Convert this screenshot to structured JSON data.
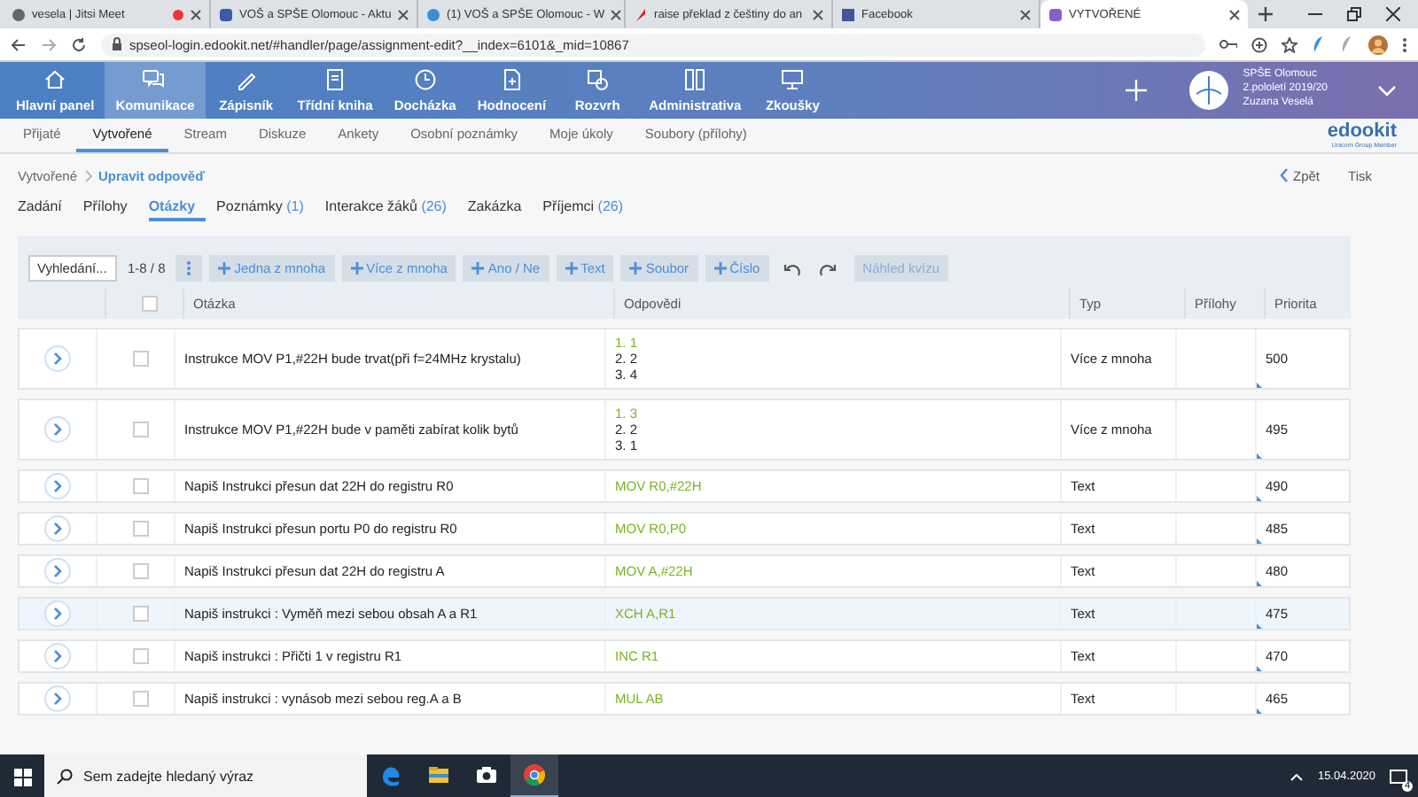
{
  "browser": {
    "tabs": [
      {
        "title": "vesela | Jitsi Meet",
        "selected": false,
        "recording": true
      },
      {
        "title": "VOŠ a SPŠE Olomouc - Aktu",
        "selected": false,
        "recording": false
      },
      {
        "title": "(1) VOŠ a SPŠE Olomouc - W",
        "selected": false,
        "recording": false
      },
      {
        "title": "raise překlad z češtiny do an",
        "selected": false,
        "recording": false
      },
      {
        "title": "Facebook",
        "selected": false,
        "recording": false
      },
      {
        "title": "VYTVOŘENÉ",
        "selected": true,
        "recording": false
      }
    ],
    "address": "spseol-login.edookit.net/#handler/page/assignment-edit?__index=6101&_mid=10867"
  },
  "app_nav": {
    "items": [
      {
        "label": "Hlavní panel",
        "selected": false
      },
      {
        "label": "Komunikace",
        "selected": true
      },
      {
        "label": "Zápisník",
        "selected": false
      },
      {
        "label": "Třídní kniha",
        "selected": false
      },
      {
        "label": "Docházka",
        "selected": false
      },
      {
        "label": "Hodnocení",
        "selected": false
      },
      {
        "label": "Rozvrh",
        "selected": false
      },
      {
        "label": "Administrativa",
        "selected": false
      },
      {
        "label": "Zkoušky",
        "selected": false
      }
    ],
    "school": [
      "SPŠE Olomouc",
      "2.pololetí 2019/20",
      "Zuzana Veselá"
    ]
  },
  "sub_nav": {
    "items": [
      {
        "label": "Přijaté",
        "selected": false
      },
      {
        "label": "Vytvořené",
        "selected": true
      },
      {
        "label": "Stream",
        "selected": false
      },
      {
        "label": "Diskuze",
        "selected": false
      },
      {
        "label": "Ankety",
        "selected": false
      },
      {
        "label": "Osobní poznámky",
        "selected": false
      },
      {
        "label": "Moje úkoly",
        "selected": false
      },
      {
        "label": "Soubory (přílohy)",
        "selected": false
      }
    ],
    "logo": "edookit",
    "logo_tagline": "Unicorn Group Member"
  },
  "breadcrumb": [
    "Vytvořené",
    "Upravit odpověď"
  ],
  "page_actions": [
    "Zpět",
    "Tisk"
  ],
  "section_tabs": [
    {
      "label": "Zadání",
      "selected": false
    },
    {
      "label": "Přílohy",
      "selected": false
    },
    {
      "label": "Otázky",
      "selected": true
    },
    {
      "label": "Poznámky",
      "count": "(1)",
      "selected": false
    },
    {
      "label": "Interakce žáků",
      "count": "(26)",
      "selected": false
    },
    {
      "label": "Zakázka",
      "selected": false
    },
    {
      "label": "Příjemci",
      "count": "(26)",
      "selected": false
    }
  ],
  "toolbar": {
    "search": {
      "placeholder": "Vyhledání..."
    },
    "count": "1-8 / 8",
    "add_buttons": [
      "Jedna z mnoha",
      "Více z mnoha",
      "Ano / Ne",
      "Text",
      "Soubor",
      "Číslo"
    ],
    "preview": {
      "label": "Náhled kvízu",
      "disabled": true
    }
  },
  "table": {
    "columns": [
      "Otázka",
      "Odpovědi",
      "Typ",
      "Přílohy",
      "Priorita"
    ],
    "header_checked": false,
    "rows": [
      {
        "question": "Instrukce MOV P1,#22H bude trvat(při f=24MHz krystalu)",
        "answers": [
          {
            "text": "1. 1",
            "correct": true
          },
          {
            "text": "2. 2",
            "correct": false
          },
          {
            "text": "3. 4",
            "correct": false
          }
        ],
        "type": "Více z mnoha",
        "priority": "500",
        "checked": false,
        "highlighted": false
      },
      {
        "question": "Instrukce MOV P1,#22H bude v paměti zabírat kolik bytů",
        "answers": [
          {
            "text": "1. 3",
            "correct": true
          },
          {
            "text": "2. 2",
            "correct": false
          },
          {
            "text": "3. 1",
            "correct": false
          }
        ],
        "type": "Více z mnoha",
        "priority": "495",
        "checked": false,
        "highlighted": false
      },
      {
        "question": "Napiš Instrukci přesun dat 22H do registru R0",
        "answers": [
          {
            "text": "MOV R0,#22H",
            "correct": true
          }
        ],
        "type": "Text",
        "priority": "490",
        "checked": false,
        "highlighted": false
      },
      {
        "question": "Napiš Instrukci přesun portu P0 do registru R0",
        "answers": [
          {
            "text": "MOV R0,P0",
            "correct": true
          }
        ],
        "type": "Text",
        "priority": "485",
        "checked": false,
        "highlighted": false
      },
      {
        "question": "Napiš Instrukci přesun dat 22H do registru A",
        "answers": [
          {
            "text": "MOV A,#22H",
            "correct": true
          }
        ],
        "type": "Text",
        "priority": "480",
        "checked": false,
        "highlighted": false
      },
      {
        "question": "Napiš instrukci : Vyměň mezi sebou obsah A a R1",
        "answers": [
          {
            "text": "XCH A,R1",
            "correct": true
          }
        ],
        "type": "Text",
        "priority": "475",
        "checked": false,
        "highlighted": true
      },
      {
        "question": "Napiš instrukci : Přičti 1 v registru R1",
        "answers": [
          {
            "text": "INC R1",
            "correct": true
          }
        ],
        "type": "Text",
        "priority": "470",
        "checked": false,
        "highlighted": false
      },
      {
        "question": "Napiš instrukci : vynásob mezi sebou reg.A a B",
        "answers": [
          {
            "text": "MUL AB",
            "correct": true
          }
        ],
        "type": "Text",
        "priority": "465",
        "checked": false,
        "highlighted": false
      }
    ]
  },
  "taskbar": {
    "search": {
      "placeholder": "Sem zadejte hledaný výraz"
    },
    "apps": [
      {
        "kind": "edge",
        "selected": false
      },
      {
        "kind": "files",
        "selected": false
      },
      {
        "kind": "camera",
        "selected": false
      },
      {
        "kind": "chrome",
        "selected": true
      }
    ],
    "date": "15.04.2020",
    "notifications": "4"
  }
}
